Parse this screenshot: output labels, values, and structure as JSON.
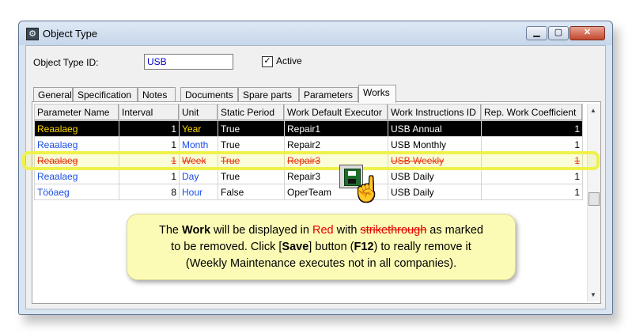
{
  "window": {
    "title": "Object Type"
  },
  "form": {
    "id_label": "Object Type ID:",
    "id_value": "USB",
    "active_label": "Active",
    "active_checked": true
  },
  "tabs": [
    "General",
    "Specification",
    "Notes",
    "Documents",
    "Spare parts",
    "Parameters",
    "Works"
  ],
  "active_tab": "Works",
  "grid": {
    "columns": [
      "Parameter Name",
      "Interval",
      "Unit",
      "Static Period",
      "Work Default Executor",
      "Work Instructions ID",
      "Rep. Work Coefficient"
    ],
    "rows": [
      {
        "name": "Reaalaeg",
        "interval": "1",
        "unit": "Year",
        "static": "True",
        "executor": "Repair1",
        "instr": "USB Annual",
        "coef": "1"
      },
      {
        "name": "Reaalaeg",
        "interval": "1",
        "unit": "Month",
        "static": "True",
        "executor": "Repair2",
        "instr": "USB Monthly",
        "coef": "1"
      },
      {
        "name": "Reaalaeg",
        "interval": "1",
        "unit": "Week",
        "static": "True",
        "executor": "Repair3",
        "instr": "USB Weekly",
        "coef": "1"
      },
      {
        "name": "Reaalaeg",
        "interval": "1",
        "unit": "Day",
        "static": "True",
        "executor": "Repair3",
        "instr": "USB Daily",
        "coef": "1"
      },
      {
        "name": "Tööaeg",
        "interval": "8",
        "unit": "Hour",
        "static": "False",
        "executor": "OperTeam",
        "instr": "USB Daily",
        "coef": "1"
      }
    ],
    "selected_row": 0,
    "deleted_row": 2
  },
  "callout": {
    "t1": "The ",
    "t2": "Work",
    "t3": " will be displayed in ",
    "t4": "Red",
    "t5": " with ",
    "t6": "strikethrough",
    "t7": " as marked",
    "t8": "to be removed.  Click [",
    "t9": "Save",
    "t10": "] button (",
    "t11": "F12",
    "t12": ") to really remove it",
    "t13": "(Weekly Maintenance executes not in all companies)."
  },
  "colors": {
    "deleted": "#e40000",
    "unit_link": "#1a4ee6",
    "selected_unit": "#ffd800",
    "highlight": "#eef24a"
  }
}
